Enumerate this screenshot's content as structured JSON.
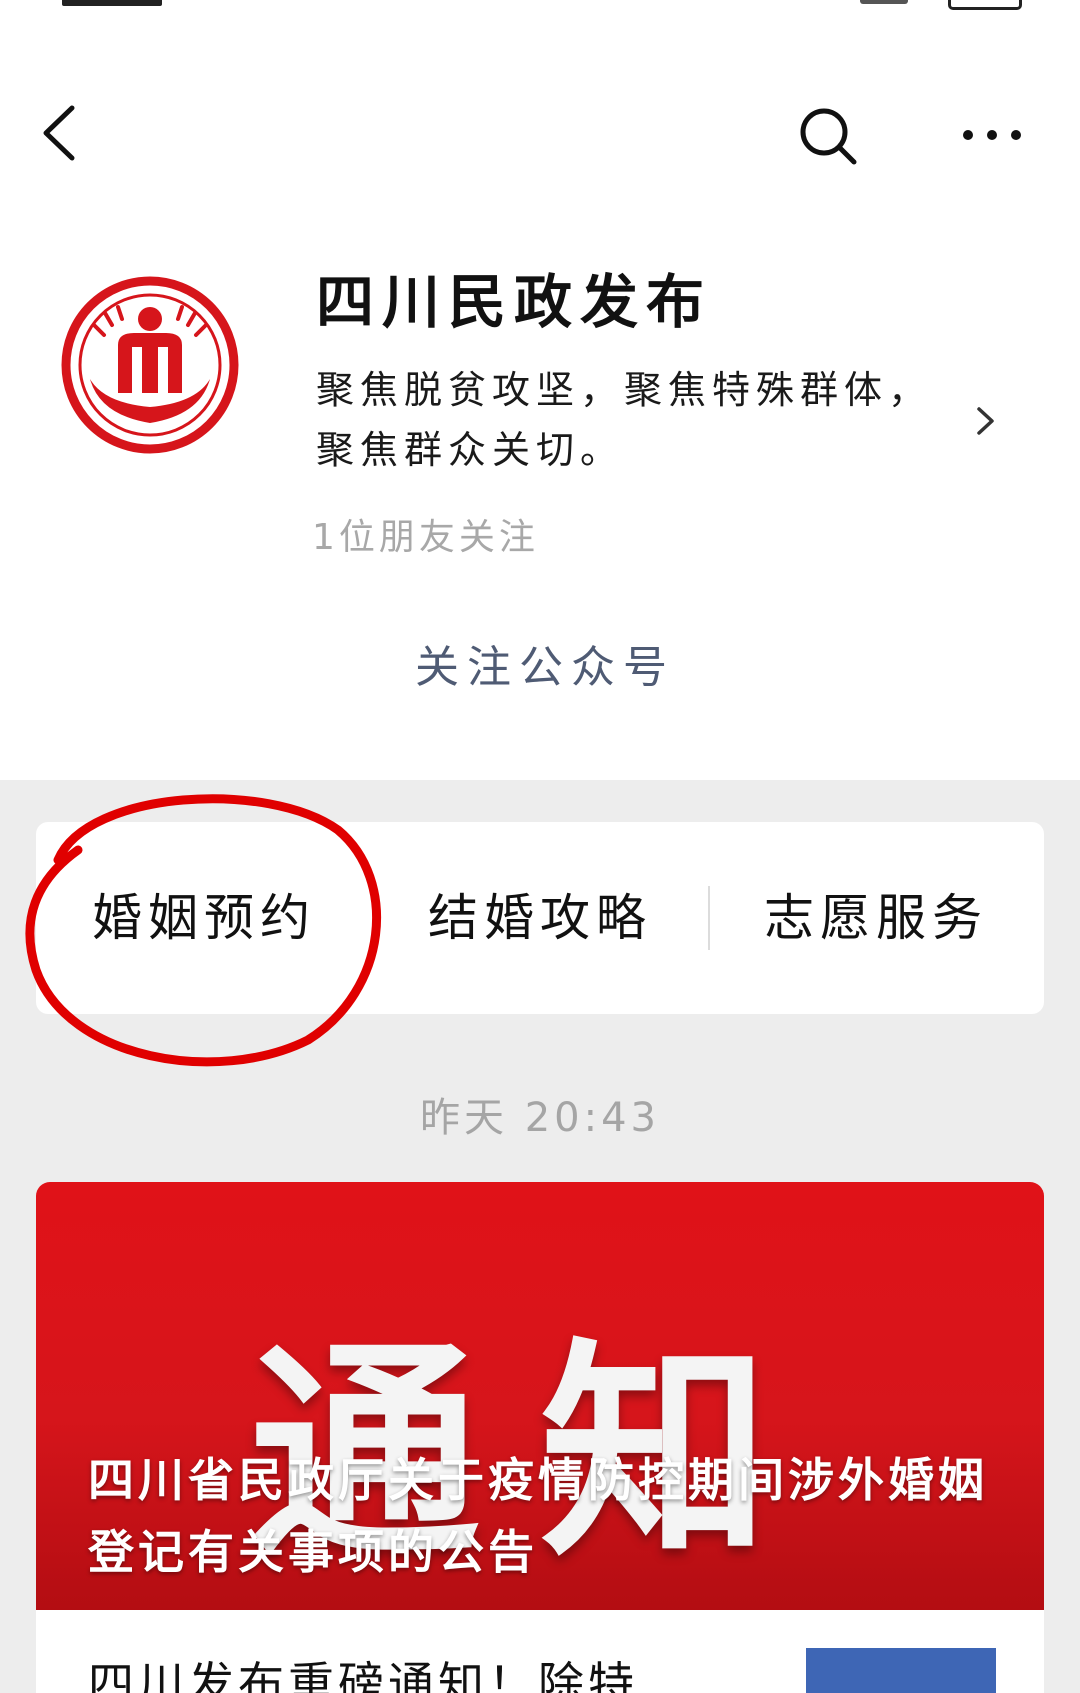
{
  "account": {
    "name": "四川民政发布",
    "description": "聚焦脱贫攻坚，聚焦特殊群体，聚焦群众关切。",
    "followers": "1位朋友关注",
    "follow_button": "关注公众号"
  },
  "menu": {
    "items": [
      {
        "label": "婚姻预约"
      },
      {
        "label": "结婚攻略"
      },
      {
        "label": "志愿服务"
      }
    ]
  },
  "feed": {
    "timestamp": "昨天 20:43",
    "article": {
      "cover_text": "通知",
      "title": "四川省民政厅关于疫情防控期间涉外婚姻登记有关事项的公告"
    },
    "next_item_title": "四川发布重磅通知！除特"
  },
  "icons": {
    "back": "back-arrow-icon",
    "search": "search-icon",
    "more": "more-icon",
    "chevron": "chevron-right-icon",
    "logo": "civil-affairs-logo"
  },
  "colors": {
    "brand_red": "#d6151b",
    "follow_text": "#4f5b74",
    "annotation_circle": "#e00000",
    "feed_background": "#ededed"
  }
}
